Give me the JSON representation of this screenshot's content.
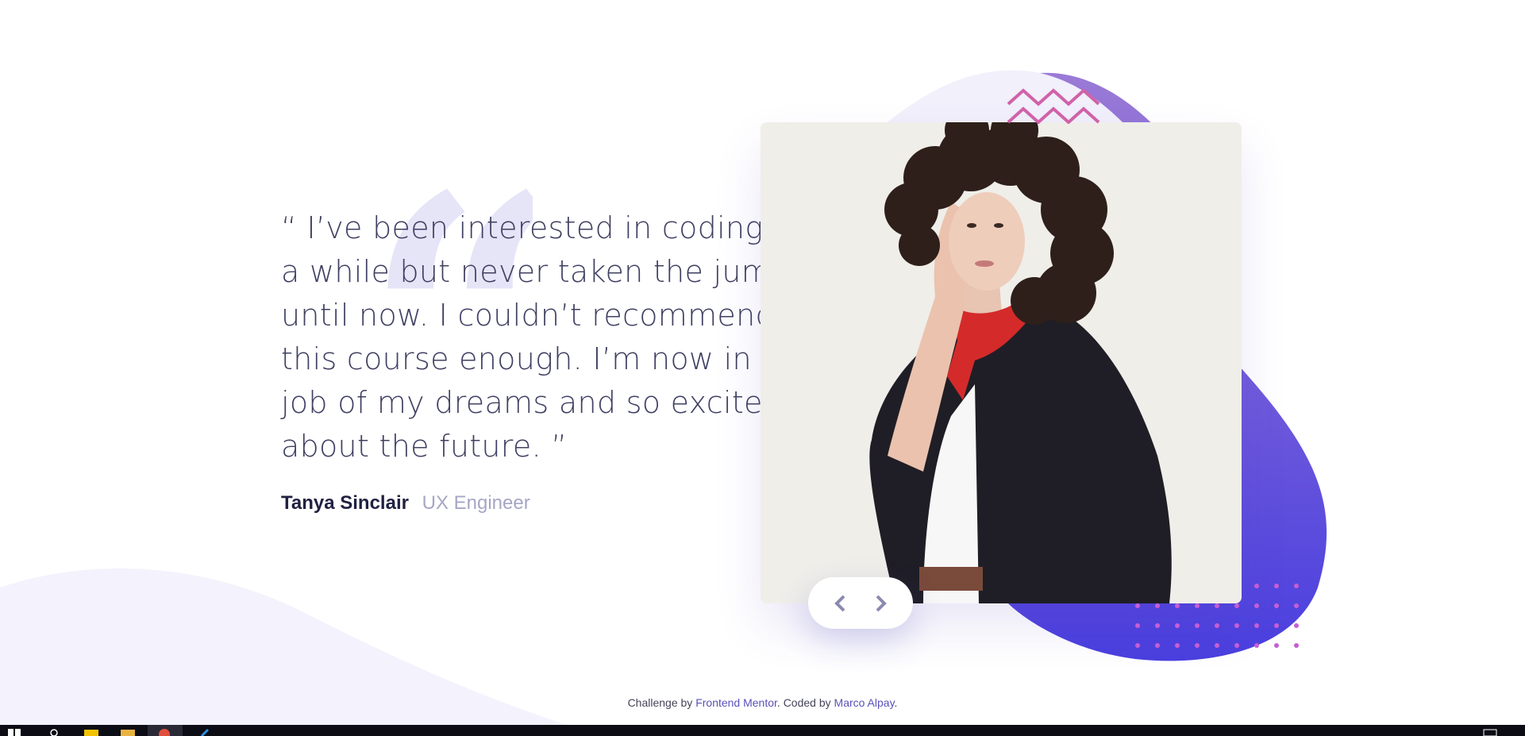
{
  "testimonial": {
    "quote": "“ I’ve been interested in coding for a while but never taken the jump, until now. I couldn’t recommend this course enough. I’m now in the job of my dreams and so excited about the future. ”",
    "author_name": "Tanya Sinclair",
    "author_role": "UX Engineer"
  },
  "navigation": {
    "prev_icon": "chevron-left-icon",
    "next_icon": "chevron-right-icon"
  },
  "footer": {
    "prefix": "Challenge by ",
    "frontend_link": "Frontend Mentor",
    "middle": ". Coded by ",
    "author_link": "Marco Alpay",
    "suffix": "."
  },
  "colors": {
    "text_dark": "#202142",
    "text_body": "#3f4062",
    "text_muted": "#a6a6c5",
    "accent_purple": "#5a51b8",
    "blob_gradient_top": "#8a6bd8",
    "blob_gradient_bottom": "#4c42e0",
    "pink": "#d162a8"
  }
}
